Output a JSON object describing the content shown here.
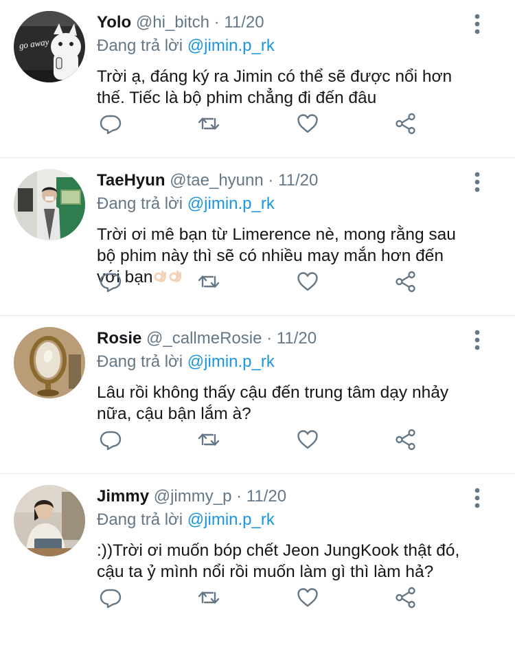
{
  "tweets": [
    {
      "display_name": "Yolo",
      "handle": "@hi_bitch",
      "separator": "·",
      "date": "11/20",
      "reply_prefix": "Đang trả lời",
      "reply_to": "@jimin.p_rk",
      "text": "Trời ạ, đáng ký ra Jimin có thể sẽ được nổi hơn\nthế. Tiếc là bộ phim chẳng đi đến đâu",
      "avatar_text": "go away"
    },
    {
      "display_name": "TaeHyun",
      "handle": "@tae_hyunn",
      "separator": "·",
      "date": "11/20",
      "reply_prefix": "Đang trả lời",
      "reply_to": "@jimin.p_rk",
      "text": "Trời ơi mê bạn từ Limerence nè, mong rằng sau\nbộ phim này thì sẽ có nhiều may mắn hơn đến\nvới bạn"
    },
    {
      "display_name": "Rosie",
      "handle": "@_callmeRosie",
      "separator": "·",
      "date": "11/20",
      "reply_prefix": "Đang trả lời",
      "reply_to": "@jimin.p_rk",
      "text": "Lâu rồi không thấy cậu đến trung tâm dạy nhảy\nnữa, cậu bận lắm à?"
    },
    {
      "display_name": "Jimmy",
      "handle": "@jimmy_p",
      "separator": "·",
      "date": "11/20",
      "reply_prefix": "Đang trả lời",
      "reply_to": "@jimin.p_rk",
      "text": ":))Trời ơi muốn bóp chết Jeon JungKook thật đó,\ncậu ta ỷ mình nổi rồi muốn làm gì thì làm hả?"
    }
  ],
  "icons": {
    "reply": "reply-icon",
    "retweet": "retweet-icon",
    "like": "like-icon",
    "share": "share-icon",
    "more": "more-vertical-icon",
    "emoji": "ok-hand-emoji"
  },
  "colors": {
    "mention": "#1b95e0",
    "muted": "#657786",
    "text": "#14171a",
    "divider": "#e6ecf0"
  }
}
